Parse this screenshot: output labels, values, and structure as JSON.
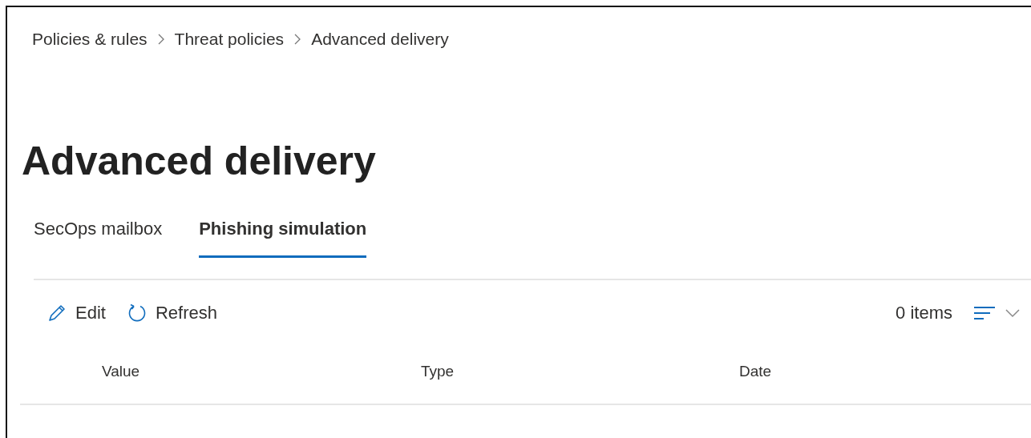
{
  "breadcrumb": [
    "Policies & rules",
    "Threat policies",
    "Advanced delivery"
  ],
  "title": "Advanced delivery",
  "tabs": [
    {
      "label": "SecOps mailbox",
      "selected": false
    },
    {
      "label": "Phishing simulation",
      "selected": true
    }
  ],
  "toolbar": {
    "actions": [
      {
        "kind": "edit",
        "label": "Edit"
      },
      {
        "kind": "refresh",
        "label": "Refresh"
      }
    ],
    "count": "0 items"
  },
  "table": {
    "columns": [
      "Value",
      "Type",
      "Date"
    ]
  }
}
